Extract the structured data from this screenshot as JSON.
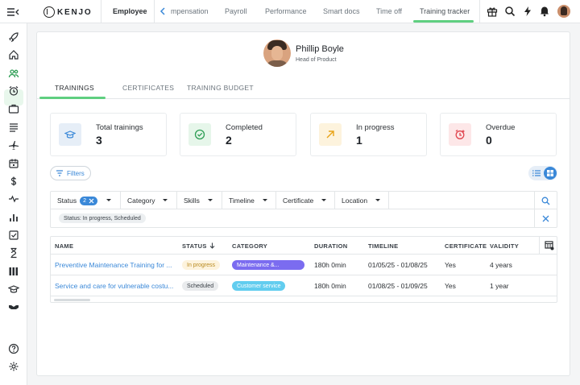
{
  "topbar": {
    "logo_text": "KENJO",
    "employee_label": "Employee",
    "tabs": [
      {
        "label": "mpensation"
      },
      {
        "label": "Payroll"
      },
      {
        "label": "Performance"
      },
      {
        "label": "Smart docs"
      },
      {
        "label": "Time off"
      },
      {
        "label": "Training tracker",
        "active": true
      }
    ],
    "icons": [
      "gift-icon",
      "search-icon",
      "lightning-icon",
      "bell-icon"
    ]
  },
  "sidebar": {
    "items": [
      "rocket-icon",
      "home-icon",
      "people-icon",
      "alarm-clock-icon",
      "briefcase-icon",
      "list-icon",
      "plane-icon",
      "calendar-icon",
      "dollar-icon",
      "pulse-icon",
      "bar-chart-icon",
      "checklist-icon",
      "hourglass-icon",
      "library-icon",
      "graduation-cap-icon",
      "handshake-icon",
      "help-icon",
      "settings-icon"
    ],
    "active": "people-icon"
  },
  "profile": {
    "name": "Phillip Boyle",
    "role": "Head of Product"
  },
  "tabs": [
    {
      "label": "TRAININGS",
      "active": true
    },
    {
      "label": "CERTIFICATES"
    },
    {
      "label": "TRAINING BUDGET"
    }
  ],
  "stats": [
    {
      "label": "Total trainings",
      "value": "3",
      "icon": "graduation-cap-icon",
      "color": "#3a88d8",
      "bg": "#e6eef7"
    },
    {
      "label": "Completed",
      "value": "2",
      "icon": "check-circle-icon",
      "color": "#2e9e55",
      "bg": "#e6f6ea"
    },
    {
      "label": "In progress",
      "value": "1",
      "icon": "arrow-up-right-icon",
      "color": "#e8a318",
      "bg": "#fdf3dd"
    },
    {
      "label": "Overdue",
      "value": "0",
      "icon": "alarm-overdue-icon",
      "color": "#e0454f",
      "bg": "#fde7e8"
    }
  ],
  "filters": {
    "button_label": "Filters",
    "status_label": "Status",
    "status_count": "2",
    "items": [
      "Category",
      "Skills",
      "Timeline",
      "Certificate",
      "Location"
    ],
    "active_chip": "Status: In progress, Scheduled"
  },
  "table": {
    "headers": [
      "NAME",
      "STATUS",
      "CATEGORY",
      "DURATION",
      "TIMELINE",
      "CERTIFICATE",
      "VALIDITY"
    ],
    "rows": [
      {
        "name": "Preventive Maintenance Training for ...",
        "status": "In progress",
        "category": "Maintenance &...",
        "category_color": "#7b6cf0",
        "duration": "180h 0min",
        "timeline": "01/05/25 - 01/08/25",
        "certificate": "Yes",
        "validity": "4 years"
      },
      {
        "name": "Service and care for vulnerable costu...",
        "status": "Scheduled",
        "category": "Customer service",
        "category_color": "#62cdef",
        "duration": "180h 0min",
        "timeline": "01/08/25 - 01/09/25",
        "certificate": "Yes",
        "validity": "1 year"
      }
    ]
  },
  "colors": {
    "accent_green": "#5fcf80",
    "accent_blue": "#3a88d8"
  }
}
